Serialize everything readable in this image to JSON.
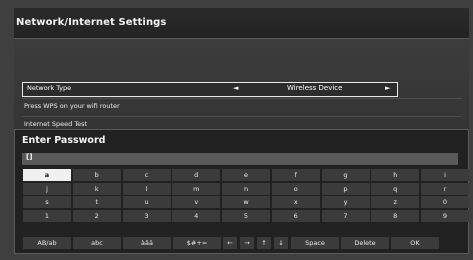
{
  "header": {
    "title": "Network/Internet Settings"
  },
  "settings": {
    "network_type": {
      "label": "Network Type",
      "value": "Wireless Device",
      "left_arrow": "◄",
      "right_arrow": "►"
    },
    "wps_hint": "Press WPS on your wifi router",
    "speed_test": "Internet Speed Test"
  },
  "dialog": {
    "title": "Enter Password",
    "password_value": "[]"
  },
  "keyboard": {
    "rows": [
      [
        "a",
        "b",
        "c",
        "d",
        "e",
        "f",
        "g",
        "h",
        "i"
      ],
      [
        "j",
        "k",
        "l",
        "m",
        "n",
        "o",
        "p",
        "q",
        "r"
      ],
      [
        "s",
        "t",
        "u",
        "v",
        "w",
        "x",
        "y",
        "z",
        "0"
      ],
      [
        "1",
        "2",
        "3",
        "4",
        "5",
        "6",
        "7",
        "8",
        "9"
      ]
    ],
    "selected_key": "a",
    "functions": [
      "AB/ab",
      "abc",
      "àâä",
      "$#+=",
      "←",
      "→",
      "↑",
      "↓",
      "Space",
      "Delete",
      "OK"
    ]
  }
}
